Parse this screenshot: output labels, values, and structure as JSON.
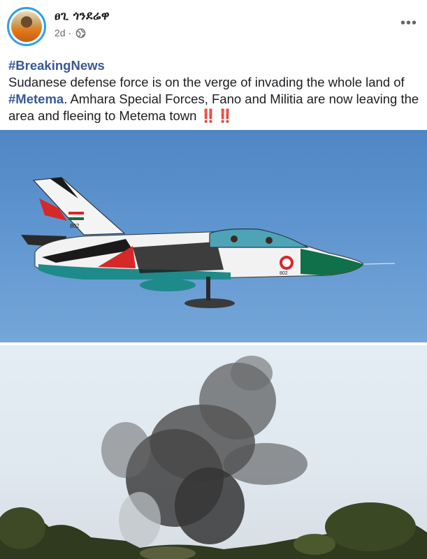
{
  "post": {
    "author": "ፀጊ ጎንደሬዋ",
    "time": "2d",
    "separator": "·",
    "privacy_icon": "globe-icon",
    "more_icon": "more-options-icon",
    "more_glyph": "•••",
    "hashtag_breaking": "#BreakingNews",
    "text_part1": "Sudanese defense force  is on the verge of invading the whole land of ",
    "hashtag_place": "#Metema",
    "text_part2": ". Amhara Special Forces, Fano and Militia are now leaving the area and fleeing to Metema town ",
    "alert_glyphs": "‼️ ‼️"
  },
  "media": {
    "photo1": {
      "subject": "jet-aircraft",
      "tail_marking": "802",
      "nose_marking": "802"
    },
    "photo2": {
      "subject": "smoke-explosion"
    }
  },
  "colors": {
    "hashtag": "#385898",
    "avatar_ring": "#2aa0ea",
    "alert": "#e0245e",
    "meta_text": "#65676b"
  }
}
